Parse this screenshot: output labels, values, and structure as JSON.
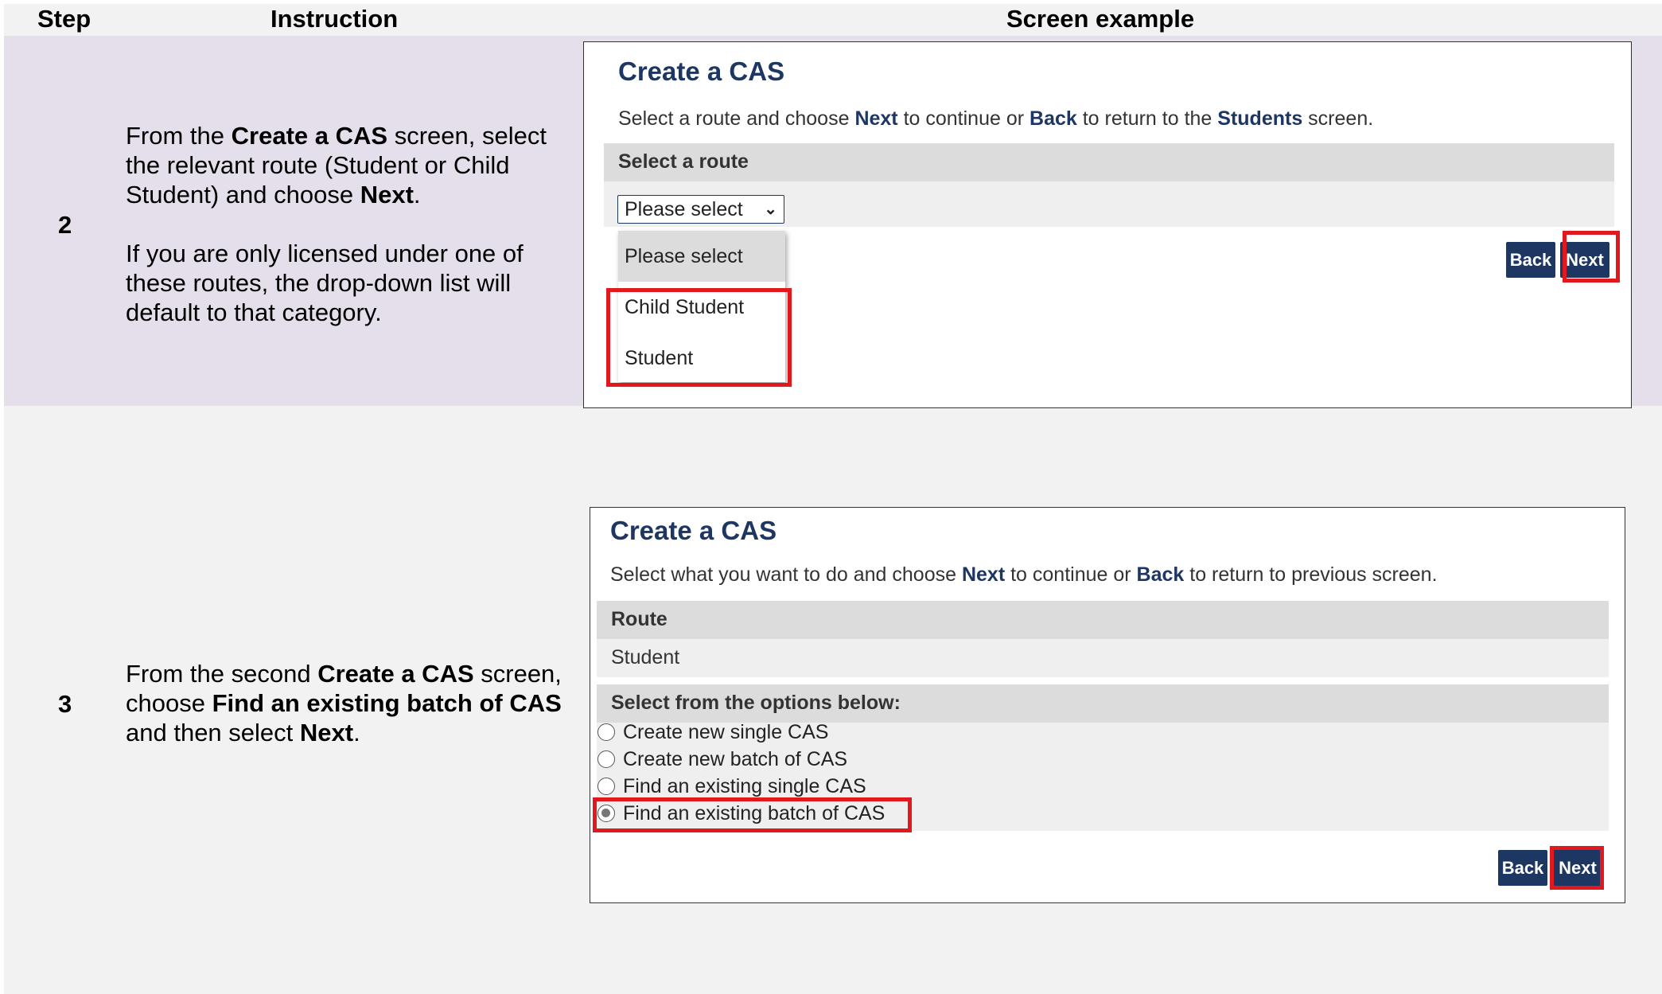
{
  "header": {
    "step": "Step",
    "instruction": "Instruction",
    "screen": "Screen example"
  },
  "row2": {
    "step": "2",
    "para1": {
      "t1": "From the ",
      "b1": "Create a CAS",
      "t2": " screen, select the relevant route (Student or Child Student) and choose ",
      "b2": "Next",
      "t3": "."
    },
    "para2": "If you are only licensed under one of these routes, the drop-down list will default to that category.",
    "screen": {
      "title": "Create a CAS",
      "desc": {
        "a": "Select a route and choose ",
        "b": "Next",
        "c": " to continue or ",
        "d": "Back",
        "e": " to return to the ",
        "f": "Students",
        "g": " screen."
      },
      "section": "Select a route",
      "select_value": "Please select",
      "options": [
        "Please select",
        "Child Student",
        "Student"
      ],
      "back": "Back",
      "next": "Next"
    }
  },
  "row3": {
    "step": "3",
    "para": {
      "t1": "From the second ",
      "b1": "Create a CAS",
      "t2": " screen, choose ",
      "b2": "Find an existing batch of CAS",
      "t3": " and then select ",
      "b3": "Next",
      "t4": "."
    },
    "screen": {
      "title": "Create a CAS",
      "desc": {
        "a": "Select what you want to do and choose ",
        "b": "Next",
        "c": " to continue or ",
        "d": "Back",
        "e": " to return to previous screen."
      },
      "route_label": "Route",
      "route_value": "Student",
      "options_label": "Select from the options below:",
      "options": [
        "Create new single CAS",
        "Create new batch of CAS",
        "Find an existing single CAS",
        "Find an existing batch of CAS"
      ],
      "selected_option": "Find an existing batch of CAS",
      "back": "Back",
      "next": "Next"
    }
  },
  "colors": {
    "navy": "#1d3662",
    "highlight": "#e0191f",
    "band": "#e4dfeb"
  }
}
